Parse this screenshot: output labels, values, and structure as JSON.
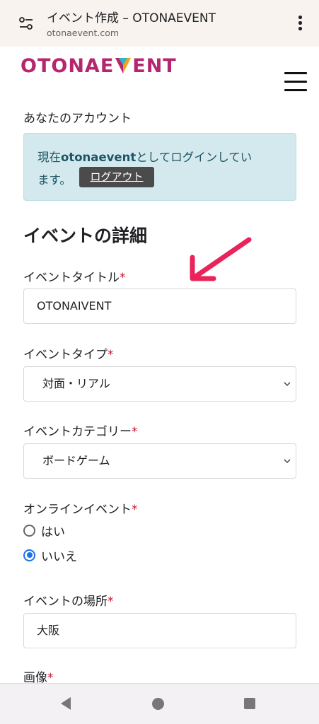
{
  "browser": {
    "title": "イベント作成 – OTONAEVENT",
    "url": "otonaevent.com"
  },
  "logo": {
    "left": "OTONAE",
    "right": "ENT",
    "text": "OTONAEVENT",
    "brand_color": "#b5266e"
  },
  "account": {
    "heading": "あなたのアカウント",
    "login_prefix": "現在",
    "username": "otonaevent",
    "login_suffix": "としてログインしてい",
    "login_line2": "ます。",
    "logout_label": "ログアウト"
  },
  "section": {
    "heading": "イベントの詳細"
  },
  "form": {
    "required_mark": "*",
    "title": {
      "label": "イベントタイトル",
      "value": "OTONAIVENT"
    },
    "type": {
      "label": "イベントタイプ",
      "selected": "対面・リアル"
    },
    "category": {
      "label": "イベントカテゴリー",
      "selected": "ボードゲーム"
    },
    "online": {
      "label": "オンラインイベント",
      "options": [
        {
          "label": "はい",
          "selected": false
        },
        {
          "label": "いいえ",
          "selected": true
        }
      ]
    },
    "location": {
      "label": "イベントの場所",
      "value": "大阪"
    },
    "image": {
      "label": "画像"
    }
  },
  "annotation": {
    "arrow_color": "#e8245a"
  },
  "icons": {
    "tune": "tune-icon",
    "more": "more-vert-icon",
    "menu": "hamburger-menu-icon",
    "chevron": "chevron-down-icon",
    "back": "nav-back-icon",
    "home": "nav-home-icon",
    "recent": "nav-recent-icon"
  }
}
